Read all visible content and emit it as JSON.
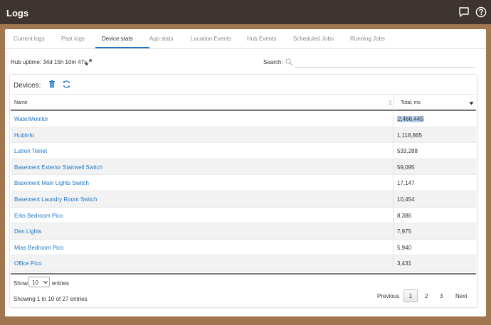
{
  "header": {
    "title": "Logs",
    "icons": [
      "chat-icon",
      "help-icon"
    ]
  },
  "tabs": [
    {
      "label": "Current logs",
      "active": false
    },
    {
      "label": "Past logs",
      "active": false
    },
    {
      "label": "Device stats",
      "active": true
    },
    {
      "label": "App stats",
      "active": false
    },
    {
      "label": "Location Events",
      "active": false
    },
    {
      "label": "Hub Events",
      "active": false
    },
    {
      "label": "Scheduled Jobs",
      "active": false
    },
    {
      "label": "Running Jobs",
      "active": false
    }
  ],
  "uptime": {
    "text": "Hub uptime: 34d 15h 10m 47s"
  },
  "search": {
    "label": "Search:",
    "value": "",
    "placeholder": ""
  },
  "devices": {
    "label": "Devices:"
  },
  "table": {
    "columns": [
      "Name",
      "Total, ms"
    ],
    "rows": [
      {
        "name": "WaterMonitor",
        "total": "2,466,445",
        "selected": true
      },
      {
        "name": "HubInfo",
        "total": "1,118,865"
      },
      {
        "name": "Lutron Telnet",
        "total": "533,288"
      },
      {
        "name": "Basement Exterior Stairwell Switch",
        "total": "59,095"
      },
      {
        "name": "Basement Main Lights Switch",
        "total": "17,147"
      },
      {
        "name": "Basement Laundry Room Switch",
        "total": "10,454"
      },
      {
        "name": "Erks Bedroom Pico",
        "total": "8,386"
      },
      {
        "name": "Den Lights",
        "total": "7,975"
      },
      {
        "name": "Mias Bedroom Pico",
        "total": "5,940"
      },
      {
        "name": "Office Pico",
        "total": "3,431"
      }
    ]
  },
  "footer": {
    "show_label": "Show",
    "page_size": "10",
    "entries_label": "entries",
    "showing_text": "Showing 1 to 10 of 27 entries",
    "pagination": {
      "previous": "Previous",
      "pages": [
        "1",
        "2",
        "3"
      ],
      "next": "Next",
      "current": "1"
    }
  },
  "colors": {
    "accent": "#1e75c4",
    "topbar": "#3e3430",
    "background": "#a0774f"
  }
}
